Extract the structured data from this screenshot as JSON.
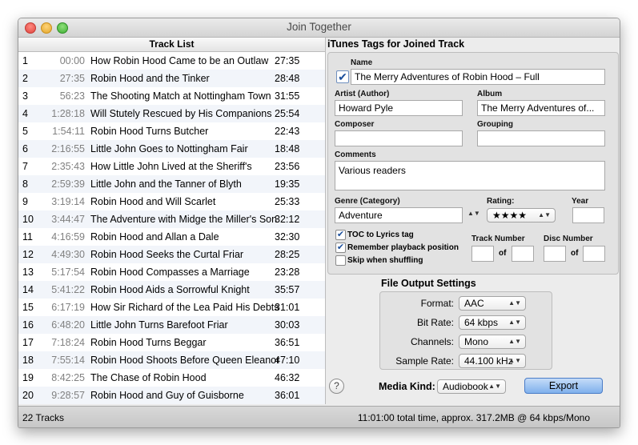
{
  "window": {
    "title": "Join Together"
  },
  "track_list": {
    "header": "Track List",
    "rows": [
      {
        "num": "1",
        "start": "00:00",
        "title": "How Robin Hood Came to be an Outlaw",
        "duration": "27:35"
      },
      {
        "num": "2",
        "start": "27:35",
        "title": "Robin Hood and the Tinker",
        "duration": "28:48"
      },
      {
        "num": "3",
        "start": "56:23",
        "title": "The Shooting Match at Nottingham Town",
        "duration": "31:55"
      },
      {
        "num": "4",
        "start": "1:28:18",
        "title": "Will Stutely Rescued by His Companions",
        "duration": "25:54"
      },
      {
        "num": "5",
        "start": "1:54:11",
        "title": "Robin Hood Turns Butcher",
        "duration": "22:43"
      },
      {
        "num": "6",
        "start": "2:16:55",
        "title": "Little John Goes to Nottingham Fair",
        "duration": "18:48"
      },
      {
        "num": "7",
        "start": "2:35:43",
        "title": "How Little John Lived at the Sheriff's",
        "duration": "23:56"
      },
      {
        "num": "8",
        "start": "2:59:39",
        "title": "Little John and the Tanner of Blyth",
        "duration": "19:35"
      },
      {
        "num": "9",
        "start": "3:19:14",
        "title": "Robin Hood and Will Scarlet",
        "duration": "25:33"
      },
      {
        "num": "10",
        "start": "3:44:47",
        "title": "The Adventure with Midge the Miller's Son",
        "duration": "32:12"
      },
      {
        "num": "11",
        "start": "4:16:59",
        "title": "Robin Hood and Allan a Dale",
        "duration": "32:30"
      },
      {
        "num": "12",
        "start": "4:49:30",
        "title": "Robin Hood Seeks the Curtal Friar",
        "duration": "28:25"
      },
      {
        "num": "13",
        "start": "5:17:54",
        "title": "Robin Hood Compasses a Marriage",
        "duration": "23:28"
      },
      {
        "num": "14",
        "start": "5:41:22",
        "title": "Robin Hood Aids a Sorrowful Knight",
        "duration": "35:57"
      },
      {
        "num": "15",
        "start": "6:17:19",
        "title": "How Sir Richard of the Lea Paid His Debts",
        "duration": "31:01"
      },
      {
        "num": "16",
        "start": "6:48:20",
        "title": "Little John Turns Barefoot Friar",
        "duration": "30:03"
      },
      {
        "num": "17",
        "start": "7:18:24",
        "title": "Robin Hood Turns Beggar",
        "duration": "36:51"
      },
      {
        "num": "18",
        "start": "7:55:14",
        "title": "Robin Hood Shoots Before Queen Eleanor",
        "duration": "47:10"
      },
      {
        "num": "19",
        "start": "8:42:25",
        "title": "The Chase of Robin Hood",
        "duration": "46:32"
      },
      {
        "num": "20",
        "start": "9:28:57",
        "title": "Robin Hood and Guy of Guisborne",
        "duration": "36:01"
      }
    ]
  },
  "status": {
    "track_count": "22 Tracks",
    "summary": "11:01:00 total time, approx. 317.2MB @ 64 kbps/Mono"
  },
  "tags": {
    "header": "iTunes Tags for Joined Track",
    "name_label": "Name",
    "name_checkbox": "✔",
    "name_value": "The Merry Adventures of Robin Hood – Full",
    "artist_label": "Artist (Author)",
    "artist_value": "Howard Pyle",
    "album_label": "Album",
    "album_value": "The Merry Adventures of...",
    "composer_label": "Composer",
    "composer_value": "",
    "grouping_label": "Grouping",
    "grouping_value": "",
    "comments_label": "Comments",
    "comments_value": "Various readers",
    "genre_label": "Genre (Category)",
    "genre_value": "Adventure",
    "rating_label": "Rating:",
    "rating_value": "★★★★",
    "year_label": "Year",
    "year_value": "",
    "toc_label": "TOC to Lyrics tag",
    "toc_check": "✔",
    "remember_label": "Remember playback position",
    "remember_check": "✔",
    "skip_label": "Skip when shuffling",
    "skip_check": "",
    "track_number_label": "Track Number",
    "disc_number_label": "Disc Number",
    "of_label": "of",
    "track_number": "",
    "track_total": "",
    "disc_number": "",
    "disc_total": ""
  },
  "output": {
    "header": "File Output Settings",
    "format_label": "Format:",
    "format_value": "AAC",
    "bitrate_label": "Bit Rate:",
    "bitrate_value": "64 kbps",
    "channels_label": "Channels:",
    "channels_value": "Mono",
    "samplerate_label": "Sample Rate:",
    "samplerate_value": "44.100 kHz"
  },
  "bottom": {
    "help": "?",
    "media_kind_label": "Media Kind:",
    "media_kind_value": "Audiobook",
    "export_label": "Export"
  },
  "icons": {
    "popup_arrow": "▲▼"
  }
}
